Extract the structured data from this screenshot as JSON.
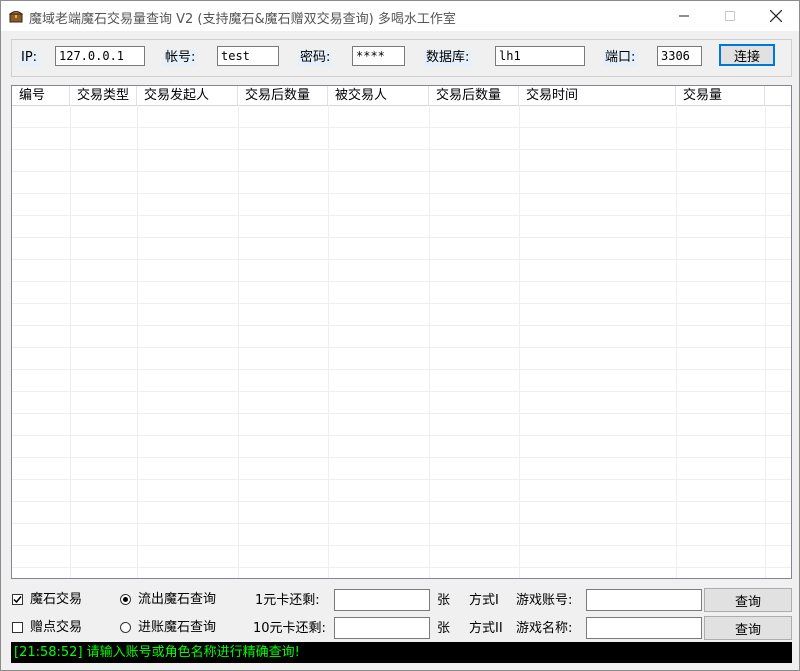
{
  "window": {
    "title": "魔域老端魔石交易量查询 V2 (支持魔石&魔石赠双交易查询) 多喝水工作室"
  },
  "connection": {
    "ip_label": "IP:",
    "ip_value": "127.0.0.1",
    "account_label": "帐号:",
    "account_value": "test",
    "password_label": "密码:",
    "password_value": "****",
    "database_label": "数据库:",
    "database_value": "lh1",
    "port_label": "端口:",
    "port_value": "3306",
    "connect_button": "连接"
  },
  "table": {
    "columns": [
      "编号",
      "交易类型",
      "交易发起人",
      "交易后数量",
      "被交易人",
      "交易后数量",
      "交易时间",
      "交易量"
    ],
    "rows": []
  },
  "options": {
    "magic_stone_trade": {
      "label": "魔石交易",
      "checked": true
    },
    "gift_point_trade": {
      "label": "赠点交易",
      "checked": false
    },
    "outflow_query": {
      "label": "流出魔石查询",
      "selected": true
    },
    "inflow_query": {
      "label": "进账魔石查询",
      "selected": false
    }
  },
  "card1": {
    "label": "1元卡还剩:",
    "value": "",
    "unit": "张",
    "method": "方式I"
  },
  "card10": {
    "label": "10元卡还剩:",
    "value": "",
    "unit": "张",
    "method": "方式II"
  },
  "game_account": {
    "label": "游戏账号:",
    "value": "",
    "button": "查询"
  },
  "game_name": {
    "label": "游戏名称:",
    "value": "",
    "button": "查询"
  },
  "status": {
    "text": "[21:58:52] 请输入账号或角色名称进行精确查询!"
  }
}
